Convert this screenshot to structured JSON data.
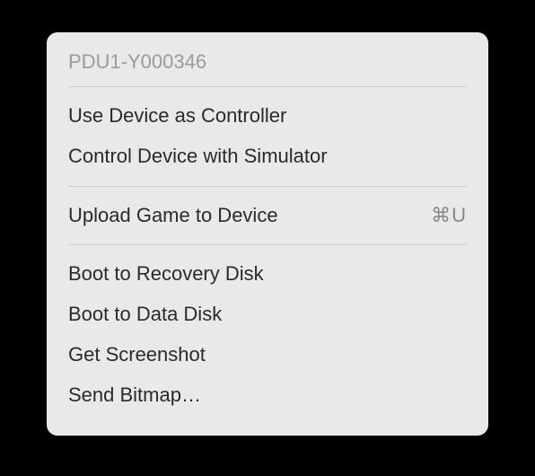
{
  "menu": {
    "header": "PDU1-Y000346",
    "groups": [
      {
        "items": [
          {
            "label": "Use Device as Controller",
            "shortcut": ""
          },
          {
            "label": "Control Device with Simulator",
            "shortcut": ""
          }
        ]
      },
      {
        "items": [
          {
            "label": "Upload Game to Device",
            "shortcut": "⌘U"
          }
        ]
      },
      {
        "items": [
          {
            "label": "Boot to Recovery Disk",
            "shortcut": ""
          },
          {
            "label": "Boot to Data Disk",
            "shortcut": ""
          },
          {
            "label": "Get Screenshot",
            "shortcut": ""
          },
          {
            "label": "Send Bitmap…",
            "shortcut": ""
          }
        ]
      }
    ]
  }
}
